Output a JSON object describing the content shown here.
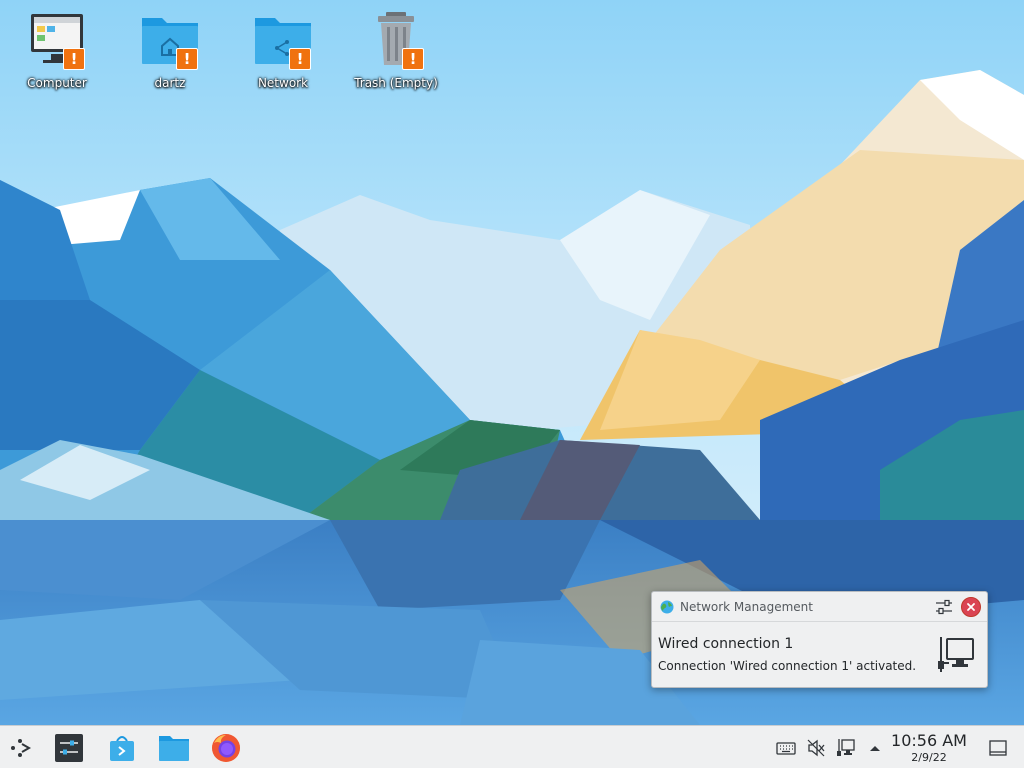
{
  "desktop": {
    "icons": [
      {
        "label": "Computer",
        "icon": "computer-icon",
        "badge": "!"
      },
      {
        "label": "dartz",
        "icon": "home-folder-icon",
        "badge": "!"
      },
      {
        "label": "Network",
        "icon": "network-folder-icon",
        "badge": "!"
      },
      {
        "label": "Trash (Empty)",
        "icon": "trash-icon",
        "badge": "!"
      }
    ]
  },
  "notification": {
    "app_name": "Network Management",
    "title": "Wired connection 1",
    "body": "Connection 'Wired connection 1' activated.",
    "app_icon": "globe-icon",
    "image": "wired-network-icon"
  },
  "taskbar": {
    "launcher_icon": "application-launcher-icon",
    "pinned": [
      {
        "name": "system-settings",
        "icon": "settings-sliders-icon"
      },
      {
        "name": "discover",
        "icon": "discover-store-icon"
      },
      {
        "name": "dolphin",
        "icon": "file-manager-folder-icon"
      },
      {
        "name": "firefox",
        "icon": "firefox-icon"
      }
    ],
    "tray": [
      "keyboard-icon",
      "volume-muted-icon",
      "network-wired-icon",
      "expand-arrow-icon"
    ],
    "clock": {
      "time": "10:56 AM",
      "date": "2/9/22"
    },
    "show_desktop_icon": "show-desktop-icon"
  },
  "colors": {
    "badge": "#f0720f",
    "close": "#da4453",
    "panel": "#eff0f1",
    "folder": "#3daee9"
  }
}
